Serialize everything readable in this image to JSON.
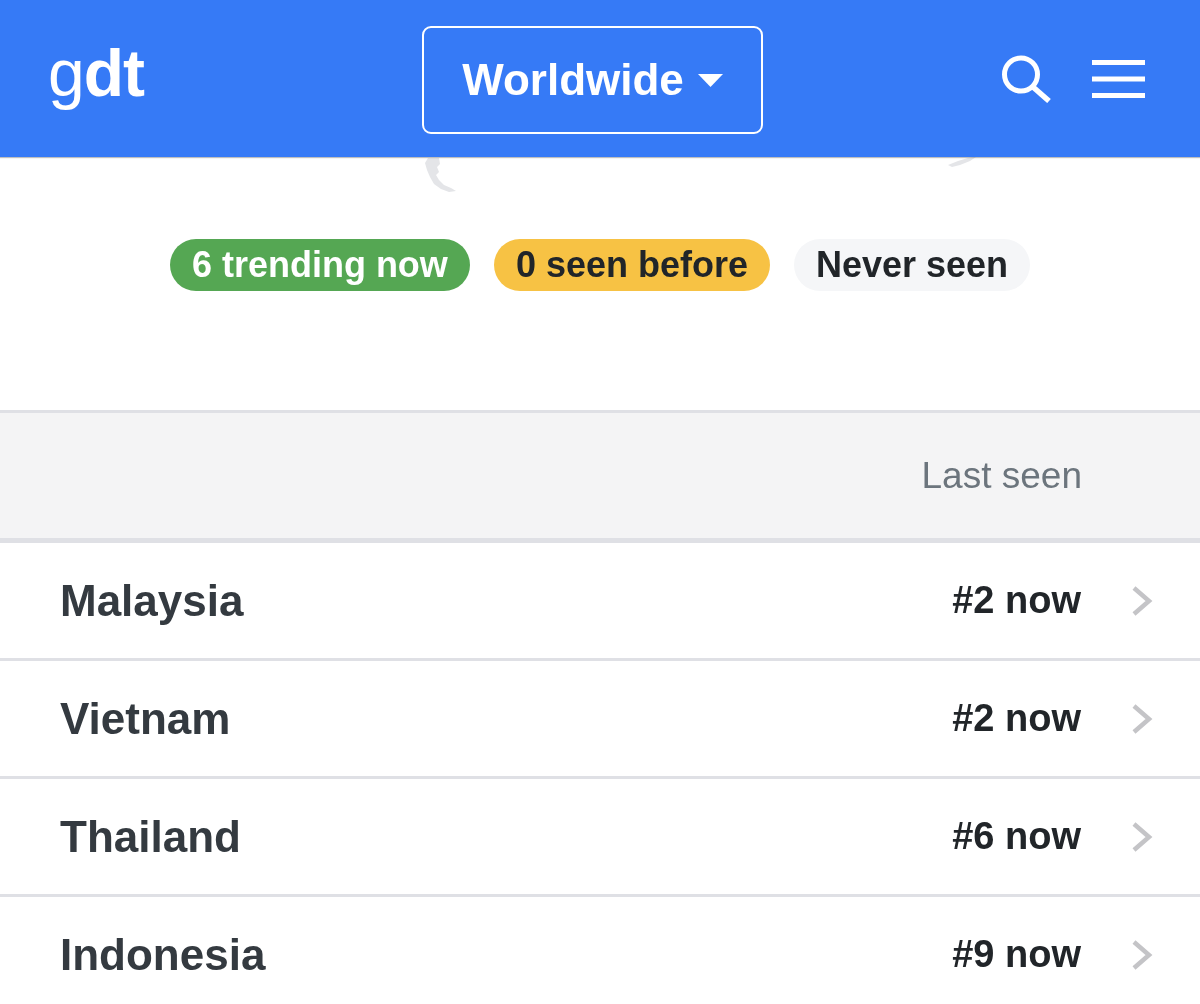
{
  "header": {
    "logo": "g**dt**",
    "region_selector": {
      "label": "Worldwide"
    }
  },
  "legend": [
    {
      "label": "6 trending now",
      "kind": "trending",
      "color": "#55a753"
    },
    {
      "label": "0 seen before",
      "kind": "seen",
      "color": "#f7c244"
    },
    {
      "label": "Never seen",
      "kind": "never",
      "color": "#f5f6f8"
    }
  ],
  "table": {
    "header": {
      "last_seen": "Last seen"
    },
    "rows": [
      {
        "country": "Malaysia",
        "last_seen": "#2 now"
      },
      {
        "country": "Vietnam",
        "last_seen": "#2 now"
      },
      {
        "country": "Thailand",
        "last_seen": "#6 now"
      },
      {
        "country": "Indonesia",
        "last_seen": "#9 now"
      }
    ]
  }
}
